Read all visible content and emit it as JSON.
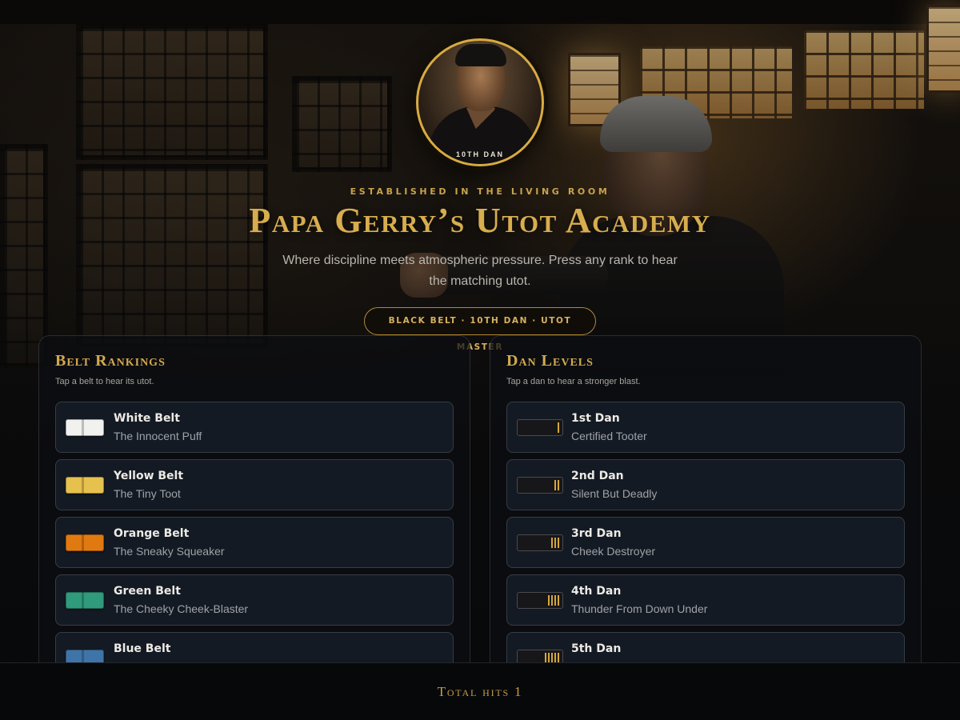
{
  "hero": {
    "avatar_rank": "10TH DAN",
    "eyebrow": "Established in the living room",
    "title": "Papa Gerry’s Utot Academy",
    "subtitle": "Where discipline meets atmospheric pressure. Press any rank to hear the matching utot.",
    "badge": "Black Belt · 10th Dan · Utot Master"
  },
  "belts_panel": {
    "title": "Belt Rankings",
    "hint": "Tap a belt to hear its utot.",
    "items": [
      {
        "name": "White Belt",
        "tagline": "The Innocent Puff",
        "color": "#f1f1f0"
      },
      {
        "name": "Yellow Belt",
        "tagline": "The Tiny Toot",
        "color": "#e6c14e"
      },
      {
        "name": "Orange Belt",
        "tagline": "The Sneaky Squeaker",
        "color": "#e07a10"
      },
      {
        "name": "Green Belt",
        "tagline": "The Cheeky Cheek-Blaster",
        "color": "#2f9a7c"
      },
      {
        "name": "Blue Belt",
        "tagline": "",
        "color": "#3f74a8"
      }
    ]
  },
  "dans_panel": {
    "title": "Dan Levels",
    "hint": "Tap a dan to hear a stronger blast.",
    "stripe_color": "#d6a63a",
    "items": [
      {
        "name": "1st Dan",
        "tagline": "Certified Tooter",
        "stripes": 1
      },
      {
        "name": "2nd Dan",
        "tagline": "Silent But Deadly",
        "stripes": 2
      },
      {
        "name": "3rd Dan",
        "tagline": "Cheek Destroyer",
        "stripes": 3
      },
      {
        "name": "4th Dan",
        "tagline": "Thunder From Down Under",
        "stripes": 4
      },
      {
        "name": "5th Dan",
        "tagline": "",
        "stripes": 5
      }
    ]
  },
  "footer": {
    "total_hits_label": "Total hits 1"
  }
}
